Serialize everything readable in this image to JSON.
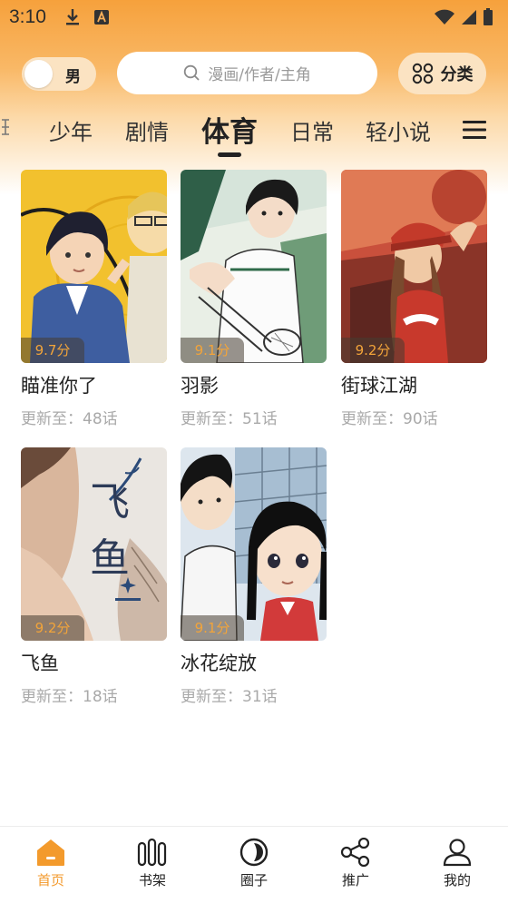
{
  "status_bar": {
    "time": "3:10"
  },
  "header": {
    "gender_label": "男",
    "search_placeholder": "漫画/作者/主角",
    "category_label": "分类"
  },
  "tabs": [
    {
      "label": "少年"
    },
    {
      "label": "剧情"
    },
    {
      "label": "体育",
      "active": true
    },
    {
      "label": "日常"
    },
    {
      "label": "轻小说"
    }
  ],
  "comics": [
    {
      "title": "瞄准你了",
      "score": "9.7分",
      "update": "更新至：48话"
    },
    {
      "title": "羽影",
      "score": "9.1分",
      "update": "更新至：51话"
    },
    {
      "title": "街球江湖",
      "score": "9.2分",
      "update": "更新至：90话"
    },
    {
      "title": "飞鱼",
      "score": "9.2分",
      "update": "更新至：18话",
      "cover_text": "飞 鱼"
    },
    {
      "title": "冰花绽放",
      "score": "9.1分",
      "update": "更新至：31话"
    }
  ],
  "bottom_nav": [
    {
      "label": "首页",
      "icon": "home-icon",
      "active": true
    },
    {
      "label": "书架",
      "icon": "bookshelf-icon"
    },
    {
      "label": "圈子",
      "icon": "circle-icon"
    },
    {
      "label": "推广",
      "icon": "share-icon"
    },
    {
      "label": "我的",
      "icon": "profile-icon"
    }
  ],
  "colors": {
    "accent": "#f39a2c",
    "header_top": "#f6a13c",
    "score_text": "#f2a43a"
  }
}
